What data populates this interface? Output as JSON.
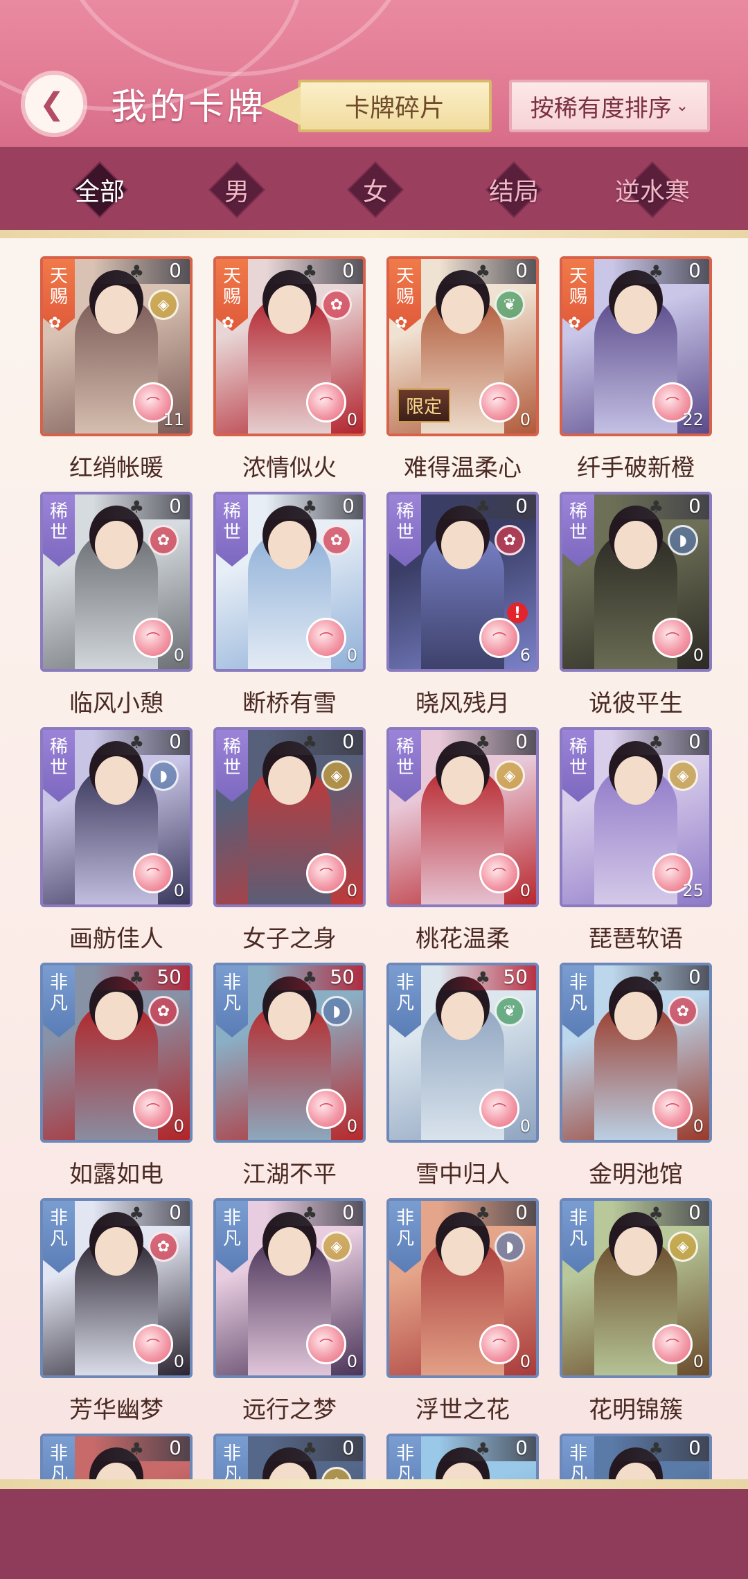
{
  "header": {
    "title": "我的卡牌",
    "back_icon": "back-arrow-icon",
    "shards_label": "卡牌碎片",
    "sort_label": "按稀有度排序",
    "colors": {
      "pink": "#e27c95",
      "gold": "#f1dc9f"
    }
  },
  "tabs": [
    {
      "label": "全部",
      "active": true
    },
    {
      "label": "男",
      "active": false
    },
    {
      "label": "女",
      "active": false
    },
    {
      "label": "结局",
      "active": false
    },
    {
      "label": "逆水寒",
      "active": false
    }
  ],
  "cards": [
    {
      "name": "红绡帐暖",
      "rarity": "天赐",
      "count_top": "0",
      "count_bottom": "11",
      "emblem": "coin-icon",
      "art": [
        "#d9c2b3",
        "#7a5a56"
      ]
    },
    {
      "name": "浓情似火",
      "rarity": "天赐",
      "count_top": "0",
      "count_bottom": "0",
      "emblem": "plum-icon",
      "art": [
        "#e8d6d6",
        "#b2242f"
      ]
    },
    {
      "name": "难得温柔心",
      "rarity": "天赐",
      "count_top": "0",
      "count_bottom": "0",
      "emblem": "jade-icon",
      "art": [
        "#f0e2d2",
        "#b05a3a"
      ],
      "limited": "限定"
    },
    {
      "name": "纤手破新橙",
      "rarity": "天赐",
      "count_top": "0",
      "count_bottom": "22",
      "emblem": "",
      "art": [
        "#c9c6e8",
        "#5a4a8a"
      ]
    },
    {
      "name": "临风小憩",
      "rarity": "稀世",
      "count_top": "0",
      "count_bottom": "0",
      "emblem": "plum-icon",
      "art": [
        "#d6dbe0",
        "#6b6f74"
      ]
    },
    {
      "name": "断桥有雪",
      "rarity": "稀世",
      "count_top": "0",
      "count_bottom": "0",
      "emblem": "plum-icon",
      "art": [
        "#e7eef6",
        "#8fb0d8"
      ]
    },
    {
      "name": "晓风残月",
      "rarity": "稀世",
      "count_top": "0",
      "count_bottom": "6",
      "emblem": "plum-icon",
      "art": [
        "#3a3e66",
        "#7a82c8"
      ],
      "alert": "!"
    },
    {
      "name": "说彼平生",
      "rarity": "稀世",
      "count_top": "0",
      "count_bottom": "0",
      "emblem": "fan-icon",
      "art": [
        "#6d6f56",
        "#2c2a24"
      ]
    },
    {
      "name": "画舫佳人",
      "rarity": "稀世",
      "count_top": "0",
      "count_bottom": "0",
      "emblem": "fan-icon",
      "art": [
        "#c8c4e6",
        "#39375a"
      ]
    },
    {
      "name": "女子之身",
      "rarity": "稀世",
      "count_top": "0",
      "count_bottom": "0",
      "emblem": "coin-icon",
      "art": [
        "#56607a",
        "#c33838"
      ]
    },
    {
      "name": "桃花温柔",
      "rarity": "稀世",
      "count_top": "0",
      "count_bottom": "0",
      "emblem": "coin-icon",
      "art": [
        "#e8c8d8",
        "#b8282e"
      ]
    },
    {
      "name": "琵琶软语",
      "rarity": "稀世",
      "count_top": "0",
      "count_bottom": "25",
      "emblem": "coin-icon",
      "art": [
        "#d8cdea",
        "#8f7ac8"
      ]
    },
    {
      "name": "如露如电",
      "rarity": "非凡",
      "count_top": "50",
      "count_bottom": "0",
      "emblem": "plum-icon",
      "art": [
        "#8892a6",
        "#b22428"
      ],
      "hot": true
    },
    {
      "name": "江湖不平",
      "rarity": "非凡",
      "count_top": "50",
      "count_bottom": "0",
      "emblem": "fan-icon",
      "art": [
        "#8aaec4",
        "#b8282a"
      ],
      "hot": true
    },
    {
      "name": "雪中归人",
      "rarity": "非凡",
      "count_top": "50",
      "count_bottom": "0",
      "emblem": "jade-icon",
      "art": [
        "#dce6ee",
        "#8fa4c0"
      ],
      "hot": true
    },
    {
      "name": "金明池馆",
      "rarity": "非凡",
      "count_top": "0",
      "count_bottom": "0",
      "emblem": "plum-icon",
      "art": [
        "#bcd6ec",
        "#9a3a2a"
      ]
    },
    {
      "name": "芳华幽梦",
      "rarity": "非凡",
      "count_top": "0",
      "count_bottom": "0",
      "emblem": "plum-icon",
      "art": [
        "#e2e6f2",
        "#2a2430"
      ]
    },
    {
      "name": "远行之梦",
      "rarity": "非凡",
      "count_top": "0",
      "count_bottom": "0",
      "emblem": "coin-icon",
      "art": [
        "#e8cde0",
        "#4a3458"
      ]
    },
    {
      "name": "浮世之花",
      "rarity": "非凡",
      "count_top": "0",
      "count_bottom": "0",
      "emblem": "fan-icon",
      "art": [
        "#e5a58a",
        "#a83a3a"
      ]
    },
    {
      "name": "花明锦簇",
      "rarity": "非凡",
      "count_top": "0",
      "count_bottom": "0",
      "emblem": "coin-icon",
      "art": [
        "#b8c89a",
        "#6a4a2a"
      ]
    },
    {
      "name": "",
      "rarity": "非凡",
      "count_top": "0",
      "count_bottom": "",
      "emblem": "",
      "art": [
        "#c86a6a",
        "#6a2a3a"
      ]
    },
    {
      "name": "",
      "rarity": "非凡",
      "count_top": "0",
      "count_bottom": "",
      "emblem": "coin-icon",
      "art": [
        "#56688a",
        "#2a3448"
      ]
    },
    {
      "name": "",
      "rarity": "非凡",
      "count_top": "0",
      "count_bottom": "",
      "emblem": "",
      "art": [
        "#9ac8e8",
        "#5a8ab8"
      ]
    },
    {
      "name": "",
      "rarity": "非凡",
      "count_top": "0",
      "count_bottom": "",
      "emblem": "",
      "art": [
        "#5a7aa8",
        "#2a3a5a"
      ]
    }
  ]
}
